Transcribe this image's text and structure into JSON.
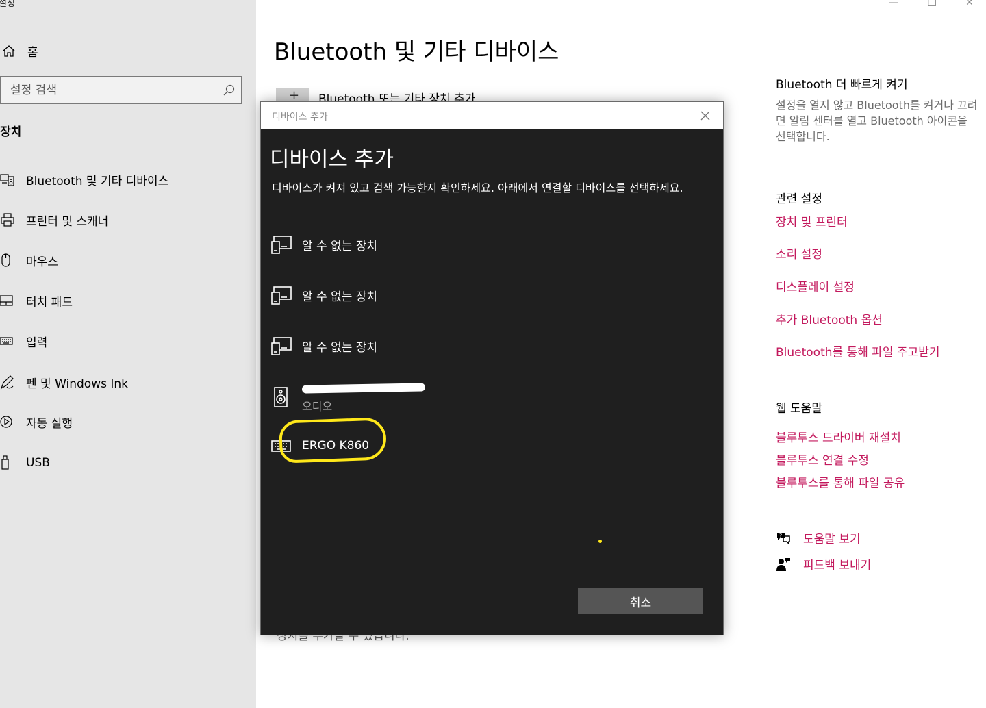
{
  "app_title": "설정",
  "sidebar": {
    "home_label": "홈",
    "search_placeholder": "설정 검색",
    "section_title": "장치",
    "items": [
      {
        "label": "Bluetooth 및 기타 디바이스",
        "icon": "bluetooth-devices-icon"
      },
      {
        "label": "프린터 및 스캐너",
        "icon": "printer-icon"
      },
      {
        "label": "마우스",
        "icon": "mouse-icon"
      },
      {
        "label": "터치 패드",
        "icon": "touchpad-icon"
      },
      {
        "label": "입력",
        "icon": "keyboard-icon"
      },
      {
        "label": "펜 및 Windows Ink",
        "icon": "pen-icon"
      },
      {
        "label": "자동 실행",
        "icon": "autoplay-icon"
      },
      {
        "label": "USB",
        "icon": "usb-icon"
      }
    ]
  },
  "main": {
    "title": "Bluetooth 및 기타 디바이스",
    "add_device_label": "Bluetooth 또는 기타 장치 추가",
    "under_dialog_text": "장치를 추가할 수 있습니다."
  },
  "right": {
    "quick_heading": "Bluetooth 더 빠르게 켜기",
    "quick_text": "설정을 열지 않고 Bluetooth를 켜거나 끄려면 알림 센터를 열고 Bluetooth 아이콘을 선택합니다.",
    "related_heading": "관련 설정",
    "related_links": [
      "장치 및 프린터",
      "소리 설정",
      "디스플레이 설정",
      "추가 Bluetooth 옵션",
      "Bluetooth를 통해 파일 주고받기"
    ],
    "web_heading": "웹 도움말",
    "web_links": [
      "블루투스 드라이버 재설치",
      "블루투스 연결 수정",
      "블루투스를 통해 파일 공유"
    ],
    "help_label": "도움말 보기",
    "feedback_label": "피드백 보내기"
  },
  "dialog": {
    "titlebar": "디바이스 추가",
    "heading": "디바이스 추가",
    "description": "디바이스가 켜져 있고 검색 가능한지 확인하세요. 아래에서 연결할 디바이스를 선택하세요.",
    "devices": [
      {
        "name": "알 수 없는 장치",
        "sub": "",
        "icon": "unknown-device-icon"
      },
      {
        "name": "알 수 없는 장치",
        "sub": "",
        "icon": "unknown-device-icon"
      },
      {
        "name": "알 수 없는 장치",
        "sub": "",
        "icon": "unknown-device-icon"
      },
      {
        "name": "",
        "sub": "오디오",
        "icon": "speaker-icon"
      },
      {
        "name": "ERGO K860",
        "sub": "",
        "icon": "keyboard-icon"
      }
    ],
    "cancel_label": "취소"
  }
}
